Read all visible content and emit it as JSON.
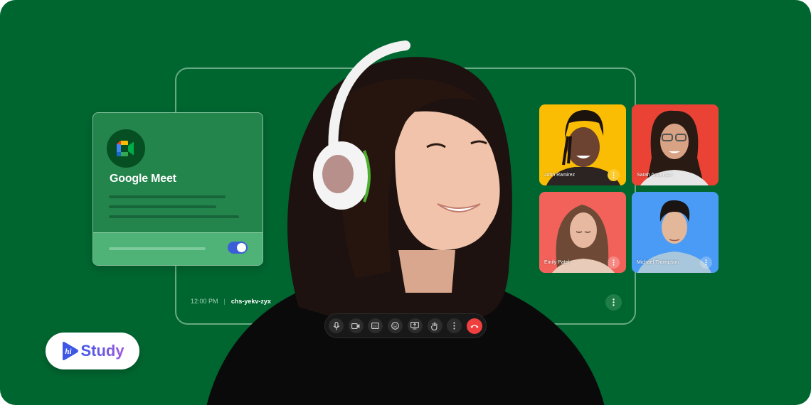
{
  "app": {
    "name": "Google Meet",
    "brand_colors": {
      "background": "#006630",
      "card": "#23844c",
      "card_footer": "#4fb277",
      "toggle": "#3b5ed8",
      "hangup": "#ef3f3f"
    }
  },
  "meet_card": {
    "logo_icon": "google-meet-logo",
    "title": "Google Meet",
    "toggle_on": true
  },
  "meeting": {
    "time": "12:00 PM",
    "separator": "|",
    "code": "chs-yekv-zyx",
    "more_icon": "more-vertical-icon"
  },
  "controls": [
    {
      "name": "microphone",
      "icon": "microphone-icon"
    },
    {
      "name": "camera",
      "icon": "video-camera-icon"
    },
    {
      "name": "captions",
      "icon": "closed-captions-icon"
    },
    {
      "name": "reactions",
      "icon": "emoji-icon"
    },
    {
      "name": "present-screen",
      "icon": "present-screen-icon"
    },
    {
      "name": "raise-hand",
      "icon": "hand-icon"
    },
    {
      "name": "more-options",
      "icon": "more-vertical-icon"
    },
    {
      "name": "leave-call",
      "icon": "hang-up-icon"
    }
  ],
  "participants": [
    {
      "name": "John Ramirez",
      "bg": "#fbbc04"
    },
    {
      "name": "Sarah Anderson",
      "bg": "#ea4335"
    },
    {
      "name": "Emily Patel",
      "bg": "#f2625a"
    },
    {
      "name": "Michael Thompson",
      "bg": "#4a9bf5"
    }
  ],
  "brand": {
    "logo_mark": "hi",
    "name": "Study"
  }
}
